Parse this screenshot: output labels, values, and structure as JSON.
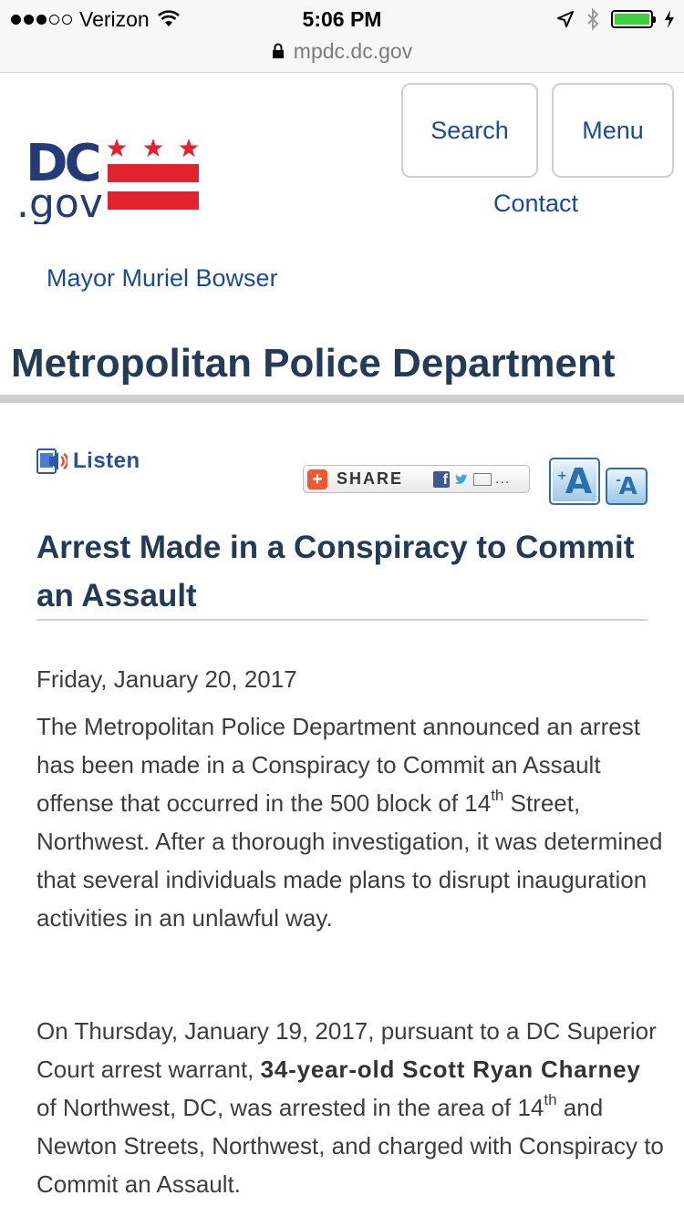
{
  "status_bar": {
    "carrier": "Verizon",
    "time": "5:06 PM",
    "url": "mpdc.dc.gov"
  },
  "header": {
    "logo_text_top": "DC",
    "logo_text_bottom": ".gov",
    "search_label": "Search",
    "menu_label": "Menu",
    "contact_label": "Contact",
    "mayor_link": "Mayor Muriel Bowser",
    "agency_title": "Metropolitan Police Department"
  },
  "tools": {
    "listen_label": "Listen",
    "share_label": "SHARE",
    "font_increase_label": "A",
    "font_decrease_label": "A"
  },
  "article": {
    "title": "Arrest Made in a Conspiracy to Commit an Assault",
    "date": "Friday, January 20, 2017",
    "p1_a": "The Metropolitan Police Department announced an arrest has been made in a Conspiracy to Commit an Assault offense that occurred in the 500 block of 14",
    "p1_sup": "th",
    "p1_b": " Street, Northwest. After a thorough investigation, it was determined that several individuals made plans to disrupt inauguration activities in an unlawful way.",
    "p2_a": "On Thursday, January 19, 2017, pursuant to a DC Superior Court arrest warrant, ",
    "p2_bold": "34-year-old Scott Ryan Charney",
    "p2_b": " of Northwest, DC, was arrested in the area of 14",
    "p2_sup": "th",
    "p2_c": " and Newton Streets, Northwest, and charged with Conspiracy to Commit an Assault."
  },
  "colors": {
    "link_blue": "#1a4a9a",
    "title_navy": "#243b58",
    "dc_red": "#e1232f",
    "battery_green": "#3fcf3a"
  }
}
